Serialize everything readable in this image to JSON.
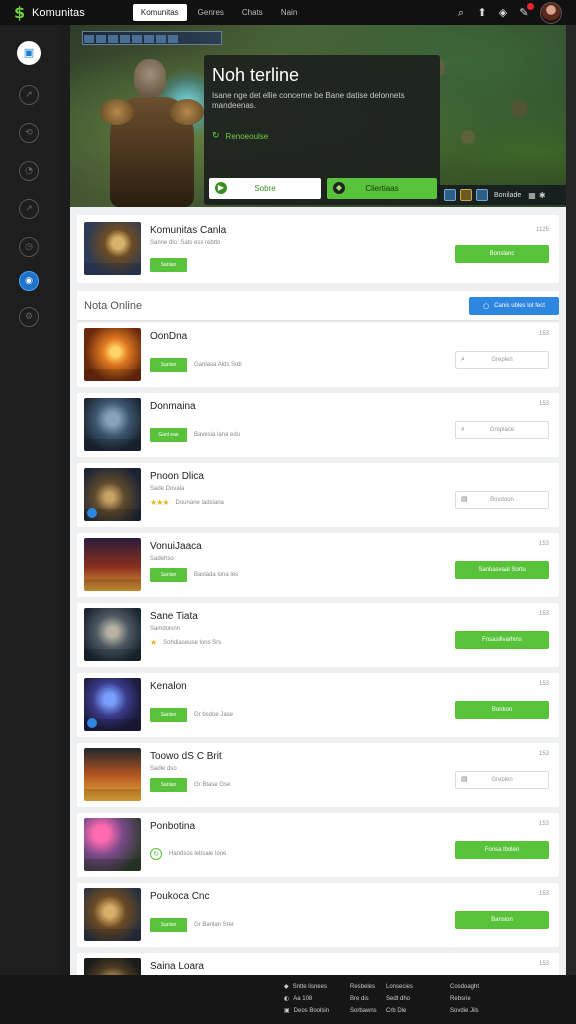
{
  "app": {
    "logo_text": "Komunitas"
  },
  "top_nav": {
    "tabs": [
      "Komunitas",
      "Genres",
      "Chats",
      "Nain"
    ]
  },
  "hero": {
    "title": "Noh terline",
    "description": "Isane nge det ellie concerne be Bane datise delonnets mandeenas.",
    "meta": "Renoeoulse",
    "btn_primary": "Sobre",
    "btn_secondary": "Cliertiaas",
    "hud_label": "Bonilade"
  },
  "featured": {
    "title": "Komunitas Canla",
    "subtitle": "Sanne dlo: Sats esx rebtto",
    "tag": "Sanlan",
    "count": "1125",
    "button": "Bonslanc"
  },
  "section": {
    "title": "Nota Online",
    "button": "Canis ubles lot fect"
  },
  "games": [
    {
      "title": "OonDna",
      "subtitle": "",
      "tag": "Sanlan",
      "meta": "Ganlasa Alds Sob",
      "count": "153",
      "button": "Greplen",
      "button_style": "outline",
      "icon": "search-icon",
      "rating": null
    },
    {
      "title": "Donmaina",
      "subtitle": "",
      "tag": "Ganl eae",
      "meta": "Bavesia lana edu",
      "count": "153",
      "button": "Greplace",
      "button_style": "outline",
      "icon": "search-icon",
      "rating": null
    },
    {
      "title": "Pnoon Dlica",
      "subtitle": "Sade Dovala",
      "tag": "",
      "meta": "Dounane ladslana",
      "count": "",
      "button": "Bovdoon",
      "button_style": "outline",
      "icon": "document-icon",
      "rating": 3
    },
    {
      "title": "VonuiJaaca",
      "subtitle": "Sadehso",
      "tag": "Sanlan",
      "meta": "Baslada lona les",
      "count": "153",
      "button": "Sanbasvaal Sortu",
      "button_style": "green",
      "icon": null,
      "rating": null
    },
    {
      "title": "Sane Tiata",
      "subtitle": "Samdolsnn",
      "tag": "",
      "meta": "Sohdiaseuse lons Srs",
      "count": "153",
      "button": "Fnsasillvarhins",
      "button_style": "green",
      "icon": null,
      "rating": 1
    },
    {
      "title": "Kenalon",
      "subtitle": "",
      "tag": "Sanlan",
      "meta": "Gr bsdoe Jase",
      "count": "153",
      "button": "Bonkon",
      "button_style": "green",
      "icon": null,
      "rating": null
    },
    {
      "title": "Toowo dS C Brit",
      "subtitle": "Sadle dso",
      "tag": "Sanlan",
      "meta": "Gr Btase Gse",
      "count": "153",
      "button": "Greplen",
      "button_style": "outline",
      "icon": "document-icon",
      "rating": null
    },
    {
      "title": "Ponbotina",
      "subtitle": "",
      "tag": "",
      "meta": "Handsos lebsale lone",
      "count": "153",
      "button": "Fonsa lbolen",
      "button_style": "green",
      "icon": "refresh-icon",
      "rating": null
    },
    {
      "title": "Poukoca Cnc",
      "subtitle": "",
      "tag": "Sanlan",
      "meta": "Gr Banlan Srer",
      "count": "153",
      "button": "Bansion",
      "button_style": "green",
      "icon": null,
      "rating": null
    },
    {
      "title": "Saina Loara",
      "subtitle": "",
      "tag": "",
      "meta": "",
      "count": "153",
      "button": "",
      "button_style": "none",
      "icon": null,
      "rating": null
    }
  ],
  "footer": {
    "col1": [
      "Sntte lisnees",
      "Aa 108",
      "Deos Boolsin"
    ],
    "col2": [
      "Resbeles",
      "Bre dis",
      "Sorbawns"
    ],
    "col3": [
      "Lonsecies",
      "Sedt dho",
      "Crb Dle"
    ],
    "col4": [
      "Cosdoaght",
      "Rebsrie",
      "Sovdie Jils"
    ]
  }
}
